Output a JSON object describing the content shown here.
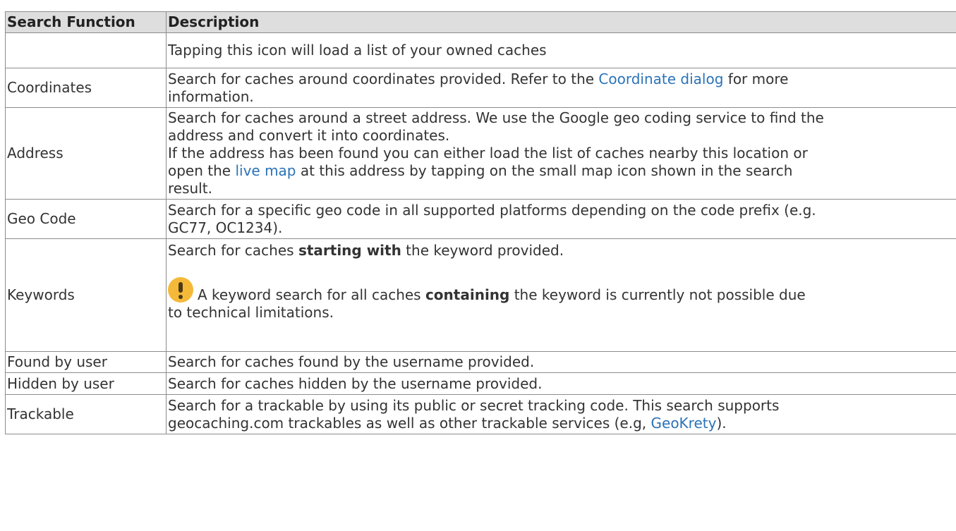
{
  "header": {
    "col1": "Search Function",
    "col2": "Description"
  },
  "rows": [
    {
      "func": "",
      "desc": "Tapping this icon will load a list of your owned caches"
    },
    {
      "func": "Coordinates",
      "desc_l1a": "Search for caches around coordinates provided. Refer to the ",
      "link": "Coordinate dialog",
      "desc_l1b": " for more",
      "desc_l2": "information."
    },
    {
      "func": "Address",
      "l1": "Search for caches around a street address. We use the Google geo coding service to find the",
      "l2": "address and convert it into coordinates.",
      "l3": "If the address has been found you can either load the list of caches nearby this location or",
      "l4a": "open the ",
      "link": "live map",
      "l4b": " at this address by tapping on the small map icon shown in the search",
      "l5": "result."
    },
    {
      "func": "Geo Code",
      "l1": "Search for a specific geo code in all supported platforms depending on the code prefix (e.g.",
      "l2": "GC77, OC1234)."
    },
    {
      "func": "Keywords",
      "l1a": "Search for caches ",
      "l1b": "starting with",
      "l1c": " the keyword provided.",
      "note_a": "A keyword search for all caches ",
      "note_b": "containing",
      "note_c": " the keyword is currently not possible due",
      "note_l2": "to technical limitations."
    },
    {
      "func": "Found by user",
      "desc": "Search for caches found by the username provided."
    },
    {
      "func": "Hidden by user",
      "desc": "Search for caches hidden by the username provided."
    },
    {
      "func": "Trackable",
      "l1": "Search for a trackable by using its public or secret tracking code. This search supports",
      "l2a": "geocaching.com trackables as well as other trackable services (e.g, ",
      "link": "GeoKrety",
      "l2b": ")."
    }
  ]
}
